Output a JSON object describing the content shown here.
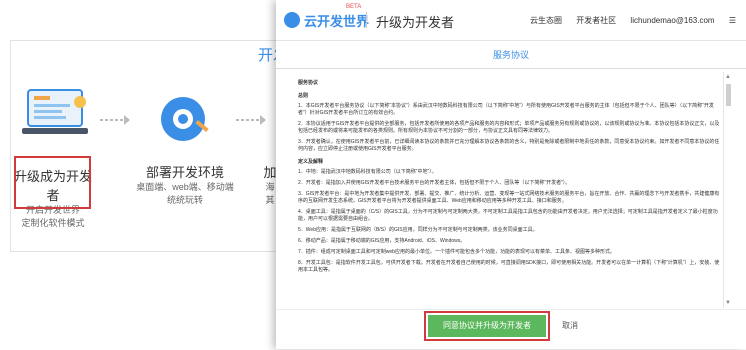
{
  "background": {
    "partial_title": "开发",
    "steps": [
      {
        "label": "升级成为开发者",
        "sub1": "开启开发世界",
        "sub2": "定制化软件模式"
      },
      {
        "label": "部署开发环境",
        "sub1": "桌面端、web端、移动端",
        "sub2": "统统玩转"
      },
      {
        "label": "加",
        "sub1": "海",
        "sub2": "其"
      }
    ]
  },
  "header": {
    "logo": "云开发世界",
    "beta": "BETA",
    "title": "升级为开发者",
    "links": [
      "云生态圈",
      "开发者社区",
      "lichundemao@163.com",
      "☰"
    ]
  },
  "dialog": {
    "subtitle": "服务协议",
    "sections": [
      {
        "h": "服务协议"
      },
      {
        "h": "总则"
      },
      {
        "p": "1．本GIS开发者平台服务协议（以下简称“本协议”）系由武汉中地数码科技有限公司（以下简称“中地”）与所有使用GIS开发者平台服务的主体（包括但不限于个人、团队等）（以下简称“开发者”）针对GIS开发者平台所订立的有效合约。"
      },
      {
        "p": "2．本协议适用于GIS开发者平台提供的全部服务，包括开发者所使用的各项产品和服务的内容和形式；单项产品或服务另有规则或协议的，以该规则或协议为准。本协议包括本协议正文，以及包括已经发布的或将来可能发布的各类规则。所有规则为本协议不可分割的一部分，与协议正文具有同等法律效力。"
      },
      {
        "p": "3．开发者确认，在使用GIS开发者平台前，已详细阅读本协议的条款并已充分理解本协议各条款的含义，特别是免除或者限制中地责任的条款，同意受本协议约束。如开发者不同意本协议的任何内容，应立即停止注册或使用GIS开发者平台服务。"
      },
      {
        "h": "定义及解释"
      },
      {
        "p": "1．中地：是指武汉中地数码科技有限公司（以下简称“中地”）。"
      },
      {
        "p": "2．开发者：是指加入并使用GIS开发者平台技术服务平台的开发者主体，包括但不限于个人、团队等（以下简称“开发者”）。"
      },
      {
        "p": "3．GIS开发者平台：是中地为开发者集中提供开发、部署、提交、推广、统计分析、运营、变现等一站式网络技术服务的服务平台，旨在开放、合作、共赢的理念下与开发者携手，共建健康有序的互联网开发生态系统。GIS开发者平台将为开发者提供桌面工具、Web应用和移动应用等多种开发工具、接口和服务。"
      },
      {
        "p": "4．桌面工具：是指属于桌面的（C/S）的GIS工具，分为不可定制与可定制两大类。不可定制工具是指工具包含的功能由开发者决定，用户无法选择；可定制工具是指开发者定义了最小粒度功能，用户可以根据需要自由组合。"
      },
      {
        "p": "5．Web应用：是指属于互联网的（B/S）的GIS应用，同样分为不可定制与可定制两类，该业务同桌面工具。"
      },
      {
        "p": "6．移动产品：是指属于移动端的GIS应用，支持Android、iOS、Windows。"
      },
      {
        "p": "7．插件：组成可定制桌面工具和可定制web应用的最小单位。一个插件可能包含多个功能，功能的表现可以有菜单、工具条、视图等多种形式。"
      },
      {
        "p": "8．开发工具包：是指软件开发工具包，可供开发者下载。开发者在开发者自己使用的时候，可直接调用SDK接口，即可使用相关功能。开发者可以在单一计算机（下称“计算机”）上，安装、使用本工具包等。"
      }
    ],
    "agree_label": "同意协议并升级为开发者",
    "cancel_label": "取消"
  },
  "colors": {
    "accent": "#3a8ee6",
    "highlight": "#d23b3b",
    "agree": "#5cb85c"
  }
}
